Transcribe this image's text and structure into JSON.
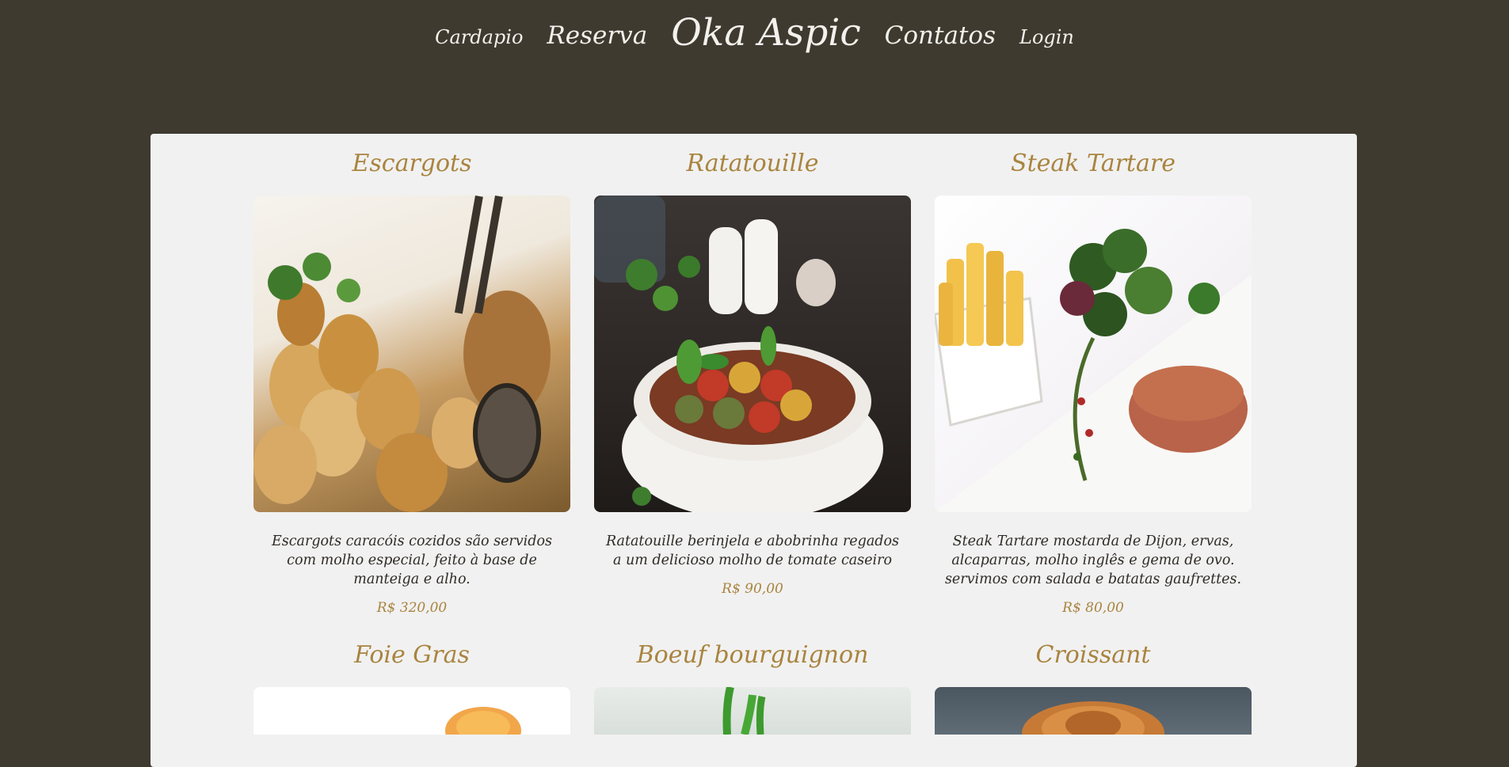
{
  "nav": {
    "cardapio": "Cardapio",
    "reserva": "Reserva",
    "brand": "Oka Aspic",
    "contatos": "Contatos",
    "login": "Login"
  },
  "dishes": [
    {
      "name": "Escargots",
      "description": "Escargots caracóis cozidos são servidos com molho especial, feito à base de manteiga e alho.",
      "price": "R$ 320,00"
    },
    {
      "name": "Ratatouille",
      "description": "Ratatouille berinjela e abobrinha regados a um delicioso molho de tomate caseiro",
      "price": "R$ 90,00"
    },
    {
      "name": "Steak Tartare",
      "description": "Steak Tartare mostarda de Dijon, ervas, alcaparras, molho inglês e gema de ovo. servimos com salada e batatas gaufrettes.",
      "price": "R$ 80,00"
    },
    {
      "name": "Foie Gras"
    },
    {
      "name": "Boeuf bourguignon"
    },
    {
      "name": "Croissant"
    }
  ],
  "colors": {
    "background": "#3e3a30",
    "panel": "#f1f1f1",
    "accent": "#a9843f",
    "nav_text": "#f3f1ec"
  }
}
